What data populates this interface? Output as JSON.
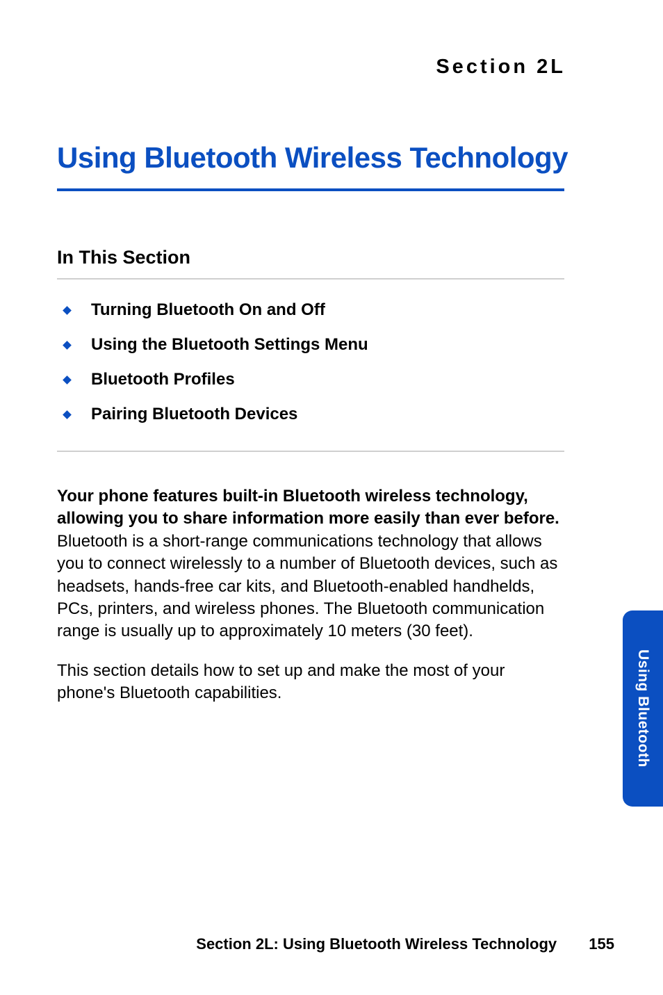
{
  "section_label": "Section 2L",
  "main_title": "Using Bluetooth Wireless Technology",
  "subsection_title": "In This Section",
  "toc": [
    "Turning Bluetooth On and Off",
    "Using the Bluetooth Settings Menu",
    "Bluetooth Profiles",
    "Pairing Bluetooth Devices"
  ],
  "para1_bold": "Your phone features built-in Bluetooth wireless technology, allowing you to share information more easily than ever before.",
  "para1_rest": " Bluetooth is a short-range communications technology that allows you to connect wirelessly to a number of Bluetooth devices, such as headsets, hands-free car kits, and Bluetooth-enabled handhelds, PCs, printers, and wireless phones. The Bluetooth communication range is usually up to approximately 10 meters (30 feet).",
  "para2": "This section details how to set up and make the most of your phone's Bluetooth capabilities.",
  "side_tab": "Using Bluetooth",
  "footer_text": "Section 2L: Using Bluetooth Wireless Technology",
  "page_number": "155"
}
